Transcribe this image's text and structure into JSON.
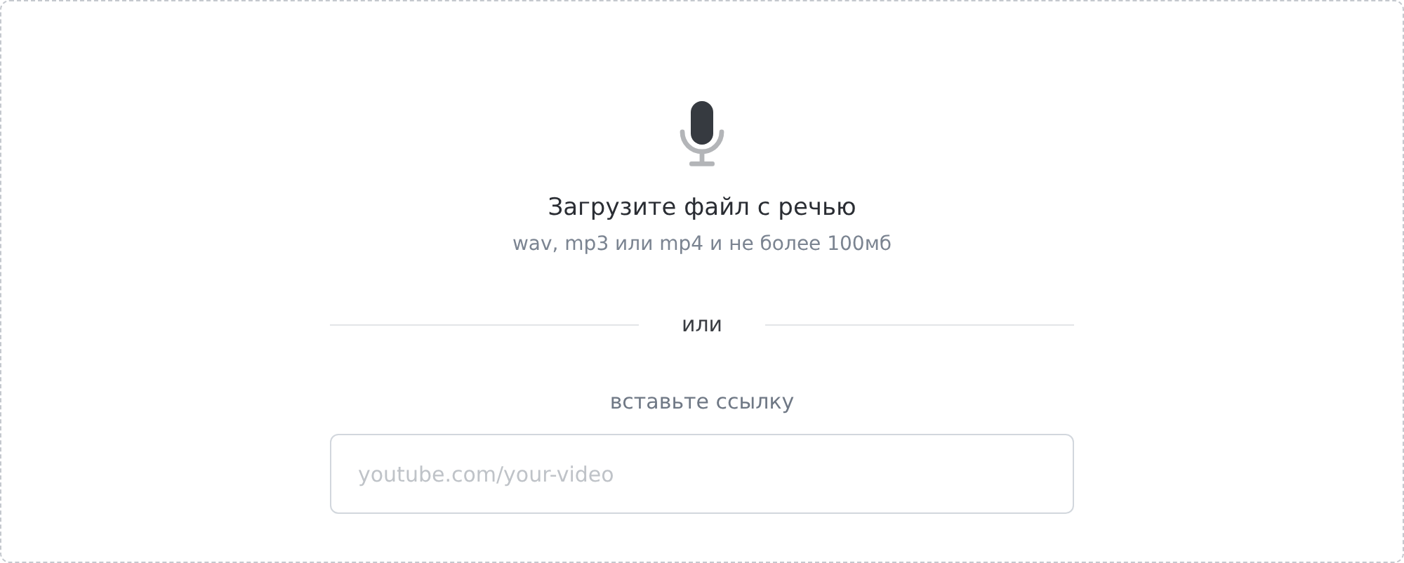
{
  "upload": {
    "title": "Загрузите файл с речью",
    "hint": "wav, mp3 или mp4 и не более 100мб"
  },
  "divider": {
    "label": "или"
  },
  "link": {
    "label": "вставьте ссылку",
    "placeholder": "youtube.com/your-video"
  }
}
